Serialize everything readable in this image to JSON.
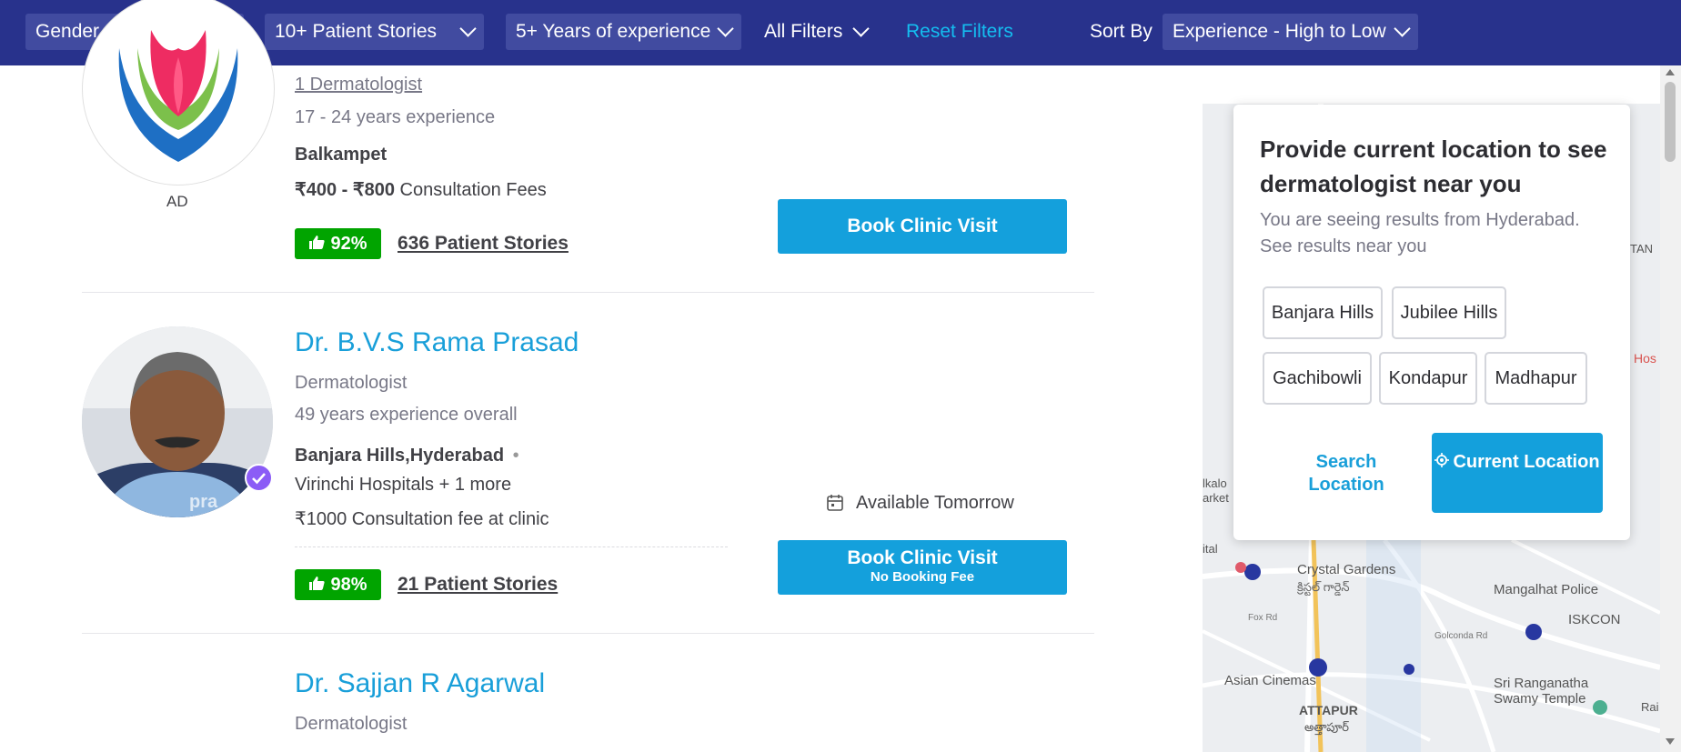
{
  "filters": {
    "gender": "Gender",
    "stories": "10+ Patient Stories",
    "experience": "5+ Years of experience",
    "all_filters": "All Filters",
    "reset": "Reset Filters",
    "sort_by_label": "Sort By",
    "sort_value": "Experience - High to Low"
  },
  "doctor1": {
    "ad_label": "AD",
    "specialty_link": "1 Dermatologist",
    "experience": "17 - 24 years experience",
    "location": "Balkampet",
    "fees_amount": "₹400 - ₹800",
    "fees_label": "Consultation Fees",
    "rating": "92%",
    "stories": "636 Patient Stories",
    "book_label": "Book Clinic Visit"
  },
  "doctor2": {
    "name": "Dr. B.V.S Rama Prasad",
    "specialty": "Dermatologist",
    "experience": "49 years experience overall",
    "location": "Banjara Hills,Hyderabad",
    "location_sep": "•",
    "clinic": "Virinchi Hospitals + 1 more",
    "fee": "₹1000 Consultation fee at clinic",
    "availability": "Available Tomorrow",
    "rating": "98%",
    "stories": "21 Patient Stories",
    "book_label": "Book Clinic Visit",
    "book_sub": "No Booking Fee",
    "photo_watermark": "pra"
  },
  "doctor3": {
    "name": "Dr. Sajjan R Agarwal",
    "specialty": "Dermatologist"
  },
  "location_popup": {
    "title": "Provide current location to see dermatologist near you",
    "subtitle": "You are seeing results from Hyderabad. See results near you",
    "chips": [
      "Banjara Hills",
      "Jubilee Hills",
      "Gachibowli",
      "Kondapur",
      "Madhapur"
    ],
    "search_label": "Search Location",
    "current_label": "Current Location"
  },
  "map": {
    "labels": [
      "Crystal Gardens",
      "క్రిస్టల్ గార్డెన్",
      "Mangalhat Police",
      "ISKCON",
      "Asian Cinemas",
      "Sri Ranganatha Swamy Temple",
      "ATTAPUR",
      "అత్తాపూర్",
      "Golconda Rd",
      "Fox Rd",
      "TAN",
      "Hos",
      "Rai",
      "lkalo",
      "arket",
      "ital"
    ]
  },
  "colors": {
    "header_bg": "#28328c",
    "dropdown_bg": "#414ba0",
    "link_blue": "#199fd9",
    "button_blue": "#14a0dc",
    "rating_green": "#01a400",
    "verified_purple": "#8b5cf6"
  }
}
